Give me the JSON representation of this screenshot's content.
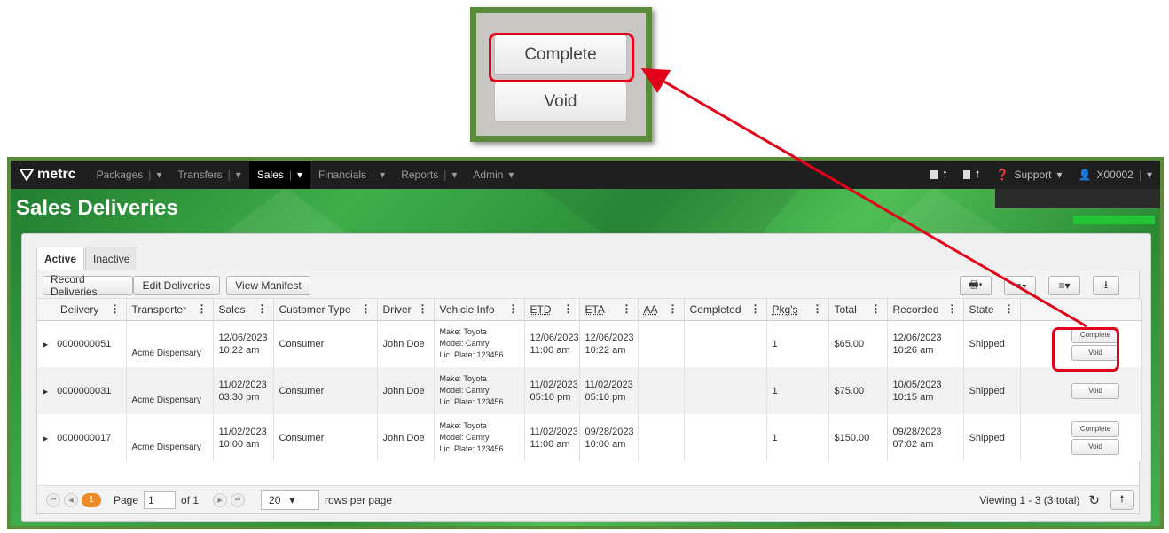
{
  "callout": {
    "complete_label": "Complete",
    "void_label": "Void"
  },
  "nav": {
    "logo": "metrc",
    "items": [
      {
        "label": "Packages",
        "active": false
      },
      {
        "label": "Transfers",
        "active": false
      },
      {
        "label": "Sales",
        "active": true
      },
      {
        "label": "Financials",
        "active": false
      },
      {
        "label": "Reports",
        "active": false
      },
      {
        "label": "Admin",
        "active": false
      }
    ],
    "support": "Support",
    "user": "X00002"
  },
  "page": {
    "title": "Sales Deliveries"
  },
  "tabs": [
    "Active",
    "Inactive"
  ],
  "toolbar": {
    "record_deliveries": "Record Deliveries",
    "edit_deliveries": "Edit Deliveries",
    "view_manifest": "View Manifest"
  },
  "table": {
    "columns": [
      "Delivery",
      "Transporter",
      "Sales",
      "Customer Type",
      "Driver",
      "Vehicle Info",
      "ETD",
      "ETA",
      "AA",
      "Completed",
      "Pkg's",
      "Total",
      "Recorded",
      "State"
    ],
    "rows": [
      {
        "delivery": "0000000051",
        "transporter": "Acme Dispensary",
        "sales_date": "12/06/2023",
        "sales_time": "10:22 am",
        "customer_type": "Consumer",
        "driver": "John Doe",
        "make": "Make: Toyota",
        "model": "Model: Camry",
        "plate": "Lic. Plate: 123456",
        "etd_date": "12/06/2023",
        "etd_time": "11:00 am",
        "eta_date": "12/06/2023",
        "eta_time": "10:22 am",
        "aa": "",
        "completed": "",
        "pkgs": "1",
        "total": "$65.00",
        "rec_date": "12/06/2023",
        "rec_time": "10:26 am",
        "state": "Shipped",
        "action1": "Complete",
        "action2": "Void"
      },
      {
        "delivery": "0000000031",
        "transporter": "Acme Dispensary",
        "sales_date": "11/02/2023",
        "sales_time": "03:30 pm",
        "customer_type": "Consumer",
        "driver": "John Doe",
        "make": "Make: Toyota",
        "model": "Model: Camry",
        "plate": "Lic. Plate: 123456",
        "etd_date": "11/02/2023",
        "etd_time": "05:10 pm",
        "eta_date": "11/02/2023",
        "eta_time": "05:10 pm",
        "aa": "",
        "completed": "",
        "pkgs": "1",
        "total": "$75.00",
        "rec_date": "10/05/2023",
        "rec_time": "10:15 am",
        "state": "Shipped",
        "action1": "Void"
      },
      {
        "delivery": "0000000017",
        "transporter": "Acme Dispensary",
        "sales_date": "11/02/2023",
        "sales_time": "10:00 am",
        "customer_type": "Consumer",
        "driver": "John Doe",
        "make": "Make: Toyota",
        "model": "Model: Camry",
        "plate": "Lic. Plate: 123456",
        "etd_date": "11/02/2023",
        "etd_time": "11:00 am",
        "eta_date": "09/28/2023",
        "eta_time": "10:00 am",
        "aa": "",
        "completed": "",
        "pkgs": "1",
        "total": "$150.00",
        "rec_date": "09/28/2023",
        "rec_time": "07:02 am",
        "state": "Shipped",
        "action1": "Complete",
        "action2": "Void"
      }
    ]
  },
  "pager": {
    "current": "1",
    "page_label": "Page",
    "page_value": "1",
    "of_label": "of 1",
    "rows_value": "20",
    "rows_label": "rows per page",
    "viewing": "Viewing 1 - 3 (3 total)"
  },
  "colors": {
    "brand_green": "#5b8b3a",
    "highlight_red": "#e3001b",
    "page_orange": "#f08a24"
  }
}
